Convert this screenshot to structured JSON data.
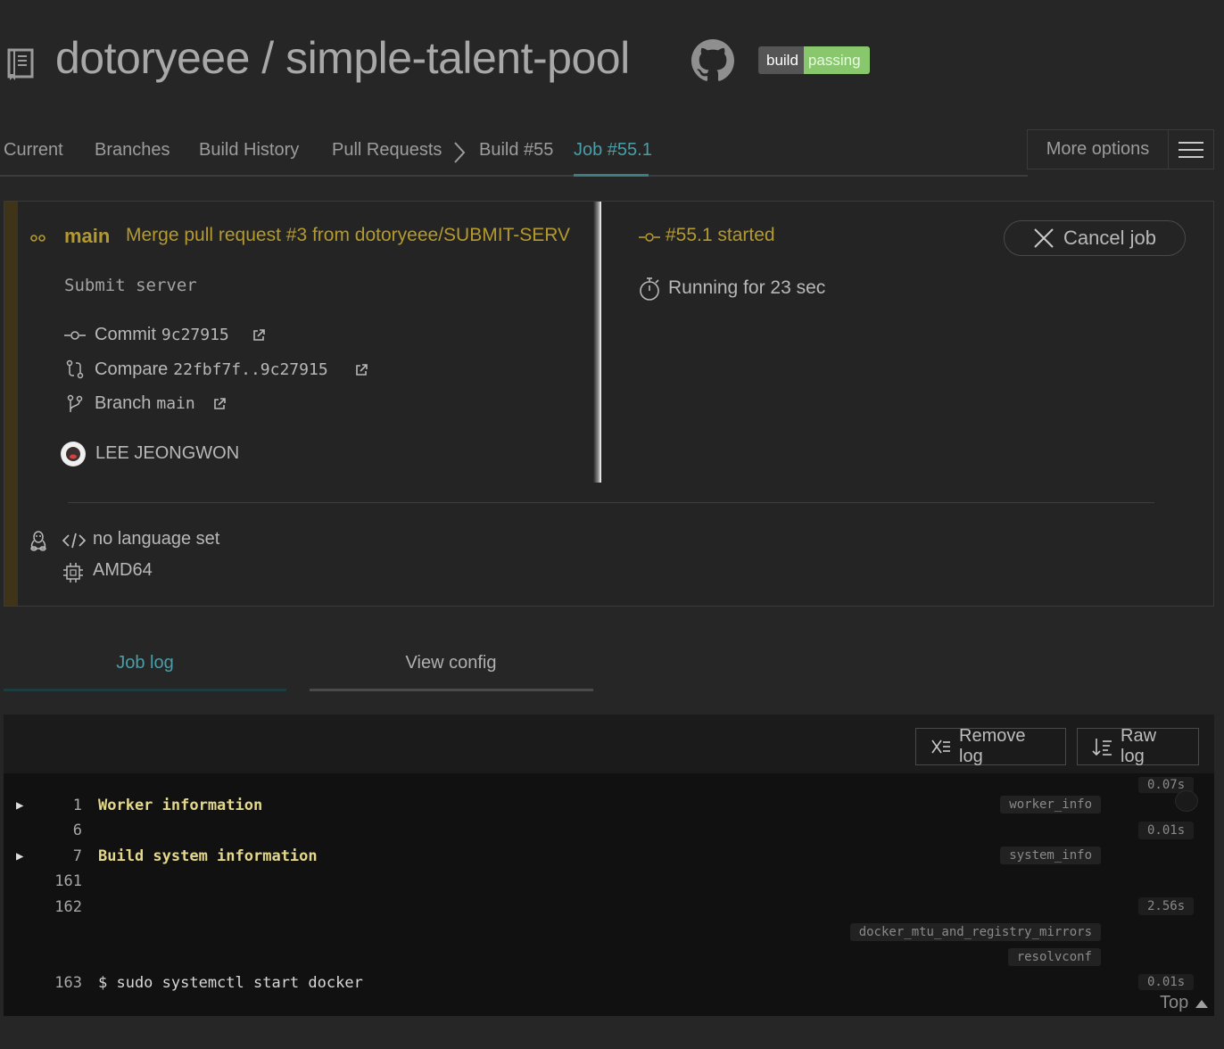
{
  "header": {
    "repo_title": "dotoryeee / simple-talent-pool",
    "badge_left": "build",
    "badge_right": "passing"
  },
  "nav": {
    "items": [
      "Current",
      "Branches",
      "Build History",
      "Pull Requests"
    ],
    "crumbs": [
      "Build #55",
      "Job #55.1"
    ],
    "more_options": "More options"
  },
  "job": {
    "branch": "main",
    "commit_message": "Merge pull request #3 from dotoryeee/SUBMIT-SERV",
    "description": "Submit server",
    "commit_label": "Commit",
    "commit_sha": "9c27915",
    "compare_label": "Compare",
    "compare_range": "22fbf7f..9c27915",
    "branch_label": "Branch",
    "branch_value": "main",
    "author": "LEE JEONGWON",
    "status": "#55.1 started",
    "running": "Running for 23 sec",
    "cancel": "Cancel job",
    "language": "no language set",
    "arch": "AMD64"
  },
  "tabs": {
    "job_log": "Job log",
    "view_config": "View config"
  },
  "log": {
    "remove_log": "Remove log",
    "raw_log": "Raw log",
    "top": "Top",
    "lines": [
      {
        "n": "1",
        "text": "Worker information",
        "tag": "worker_info",
        "time": "0.07s"
      },
      {
        "n": "6",
        "text": "",
        "time": "0.01s"
      },
      {
        "n": "7",
        "text": "Build system information",
        "tag": "system_info"
      },
      {
        "n": "161",
        "text": ""
      },
      {
        "n": "162",
        "text": "",
        "time": "2.56s",
        "tags": [
          "docker_mtu_and_registry_mirrors",
          "resolvconf"
        ]
      },
      {
        "n": "163",
        "text": "$ sudo systemctl start docker",
        "time": "0.01s"
      }
    ]
  }
}
